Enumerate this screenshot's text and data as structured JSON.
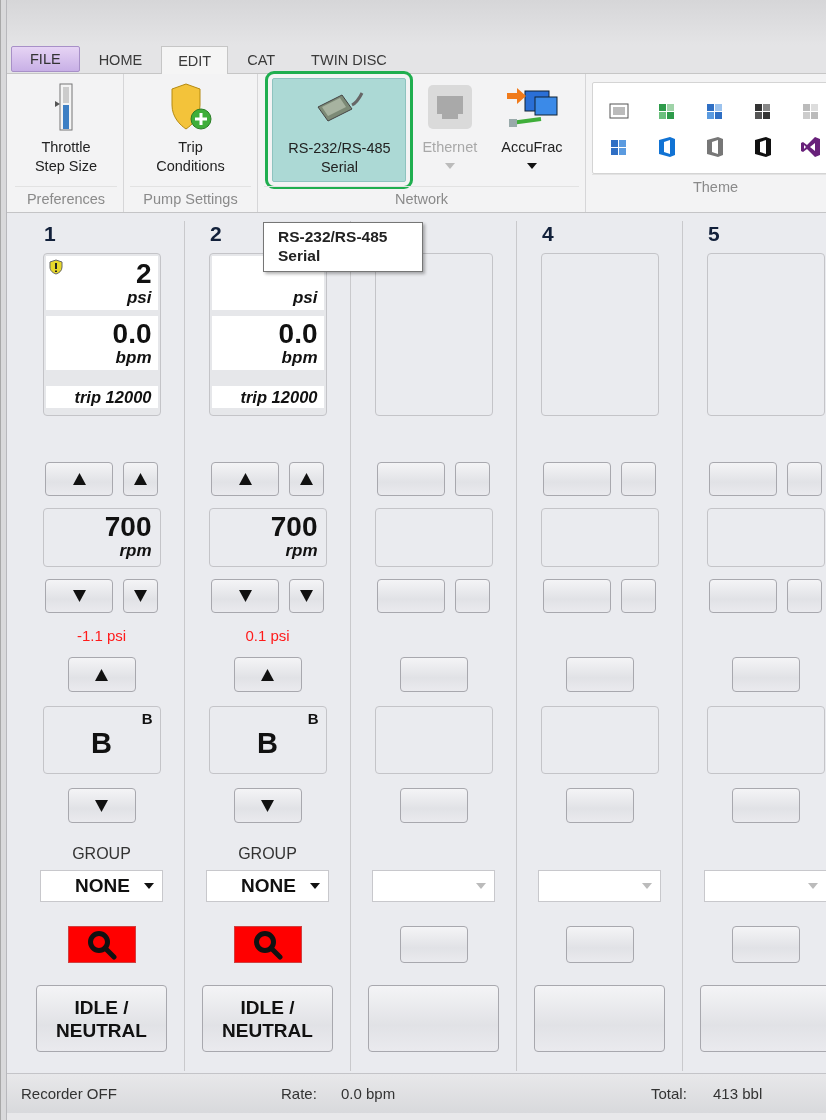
{
  "tabs": [
    {
      "label": "FILE",
      "kind": "file",
      "selected": false
    },
    {
      "label": "HOME",
      "kind": "tab",
      "selected": false
    },
    {
      "label": "EDIT",
      "kind": "tab",
      "selected": true
    },
    {
      "label": "CAT",
      "kind": "tab",
      "selected": false
    },
    {
      "label": "TWIN DISC",
      "kind": "tab",
      "selected": false
    }
  ],
  "ribbon_groups": [
    {
      "label": "Preferences",
      "kind": "buttons",
      "buttons": [
        {
          "kind": "throttle",
          "lines": [
            "Throttle",
            "Step Size"
          ],
          "selected": false,
          "disabled": false,
          "dropdown": false
        }
      ]
    },
    {
      "label": "Pump Settings",
      "kind": "buttons",
      "buttons": [
        {
          "kind": "trip",
          "lines": [
            "Trip",
            "Conditions"
          ],
          "selected": false,
          "disabled": false,
          "dropdown": false
        }
      ]
    },
    {
      "label": "Network",
      "kind": "buttons",
      "buttons": [
        {
          "kind": "serial",
          "lines": [
            "RS-232/RS-485",
            "Serial"
          ],
          "selected": true,
          "disabled": false,
          "dropdown": false
        },
        {
          "kind": "ethernet",
          "lines": [
            "Ethernet"
          ],
          "selected": false,
          "disabled": true,
          "dropdown": true
        },
        {
          "kind": "accufrac",
          "lines": [
            "AccuFrac"
          ],
          "selected": false,
          "disabled": false,
          "dropdown": true
        }
      ]
    },
    {
      "label": "Theme",
      "kind": "gallery"
    }
  ],
  "tooltip": {
    "lines": [
      "RS-232/RS-485",
      "Serial"
    ]
  },
  "pumps": [
    {
      "kind": "active",
      "number": "1",
      "warning": true,
      "pressure": "2",
      "pressure_unit": "psi",
      "rate": "0.0",
      "rate_unit": "bpm",
      "trip": "trip 12000",
      "rpm": "700",
      "rpm_unit": "rpm",
      "delta": "-1.1 psi",
      "gear": "B",
      "gear_mark": "B",
      "group_label": "GROUP",
      "group": "NONE",
      "alarm": true,
      "action": [
        "IDLE /",
        "NEUTRAL"
      ]
    },
    {
      "kind": "active",
      "number": "2",
      "warning": false,
      "pressure_unit": "psi",
      "rate": "0.0",
      "rate_unit": "bpm",
      "trip": "trip 12000",
      "rpm": "700",
      "rpm_unit": "rpm",
      "delta": "0.1 psi",
      "gear": "B",
      "gear_mark": "B",
      "group_label": "GROUP",
      "group": "NONE",
      "alarm": true,
      "action": [
        "IDLE /",
        "NEUTRAL"
      ]
    },
    {
      "kind": "empty"
    },
    {
      "kind": "empty",
      "number": "4"
    },
    {
      "kind": "empty",
      "number": "5"
    }
  ],
  "status_bar": {
    "recorder": "Recorder OFF",
    "rate_label": "Rate:",
    "rate": "0.0 bpm",
    "total_label": "Total:",
    "total": "413 bbl"
  }
}
